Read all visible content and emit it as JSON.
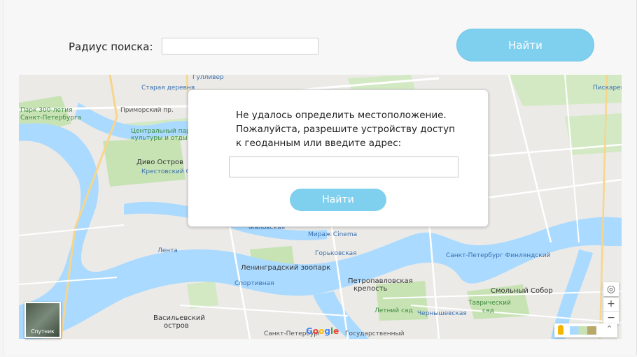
{
  "search": {
    "radius_label": "Радиус поиска:",
    "radius_value": "",
    "find_label": "Найти"
  },
  "modal": {
    "message": "Не удалось определить местоположение. Пожалуйста, разрешите устройству доступ к геоданным или введите адрес:",
    "address_value": "",
    "find_label": "Найти"
  },
  "map": {
    "satellite_label": "Спутник",
    "zoom_in": "+",
    "zoom_out": "−",
    "locate_icon": "crosshair-icon",
    "pegman_icon": "pegman-icon",
    "expand_icon": "chevron-up-icon",
    "labels": {
      "gulliver": "Гулливер",
      "staraya_derevnya": "Старая деревня",
      "park_300": "Парк 300-летия",
      "spb": "Санкт-Петербурга",
      "primorsky": "Приморский пр.",
      "central_park": "Центральный парк",
      "culture": "культуры и отдыха",
      "divo_ostrov": "Диво Остров",
      "krestovsky": "Крестовский Остров",
      "chkalovskaya": "Чкаловская",
      "mirazh": "Мираж Cinema",
      "gorkovskaya": "Горьковская",
      "lenta": "Лента",
      "zoo": "Ленинградский зоопарк",
      "petropavlovsk": "Петропавловская",
      "krepost": "крепость",
      "sportivnaya": "Спортивная",
      "letny_sad": "Летний сад",
      "tavrichesky": "Таврический",
      "sad": "сад",
      "smolny": "Смольный Собор",
      "vasilievsky": "Васильевский",
      "ostrov": "остров",
      "spb_state": "Государственный",
      "spb_bottom": "Санкт-Петербург",
      "chernyshevskaya": "Чернышевская",
      "finlyandsky": "Санкт-Петербург Финляндский",
      "pisk": "Пискаревка"
    }
  }
}
